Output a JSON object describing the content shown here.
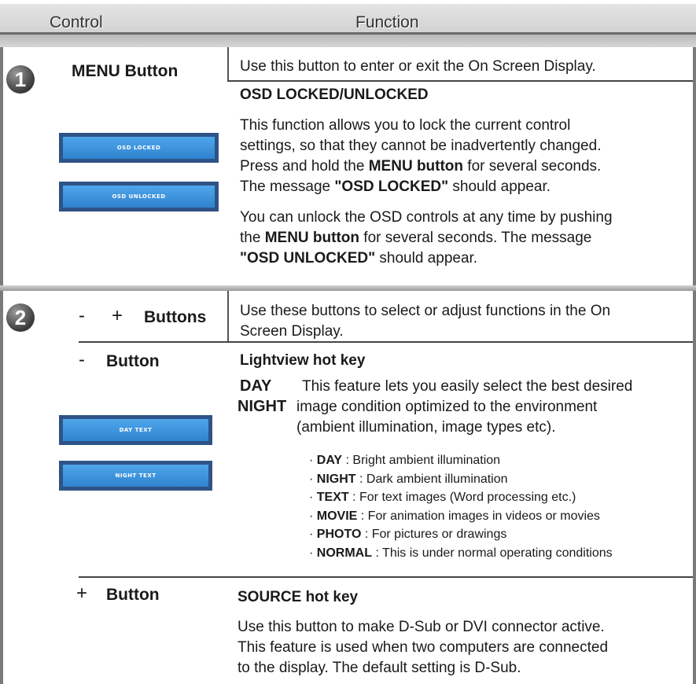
{
  "header": {
    "control": "Control",
    "function": "Function"
  },
  "row1": {
    "number": "1",
    "control_label": "MENU Button",
    "desc": "Use this button to enter or exit the On Screen Display.",
    "osd_title": "OSD LOCKED/UNLOCKED",
    "p1_a": "This function allows you to lock the current control",
    "p1_b": "settings, so that they cannot be inadvertently changed.",
    "p1_c1": "Press and hold the ",
    "p1_c2": "MENU button",
    "p1_c3": " for several seconds.",
    "p1_d1": "The message ",
    "p1_d2": "\"OSD LOCKED\"",
    "p1_d3": " should appear.",
    "p2_a": "You can unlock the OSD controls at any time by pushing",
    "p2_b1": "the ",
    "p2_b2": "MENU button",
    "p2_b3": " for several seconds. The message",
    "p2_c1": "\"OSD UNLOCKED\"",
    "p2_c2": " should appear.",
    "osd_locked": "OSD LOCKED",
    "osd_unlocked": "OSD UNLOCKED"
  },
  "row2": {
    "number": "2",
    "minus": "-",
    "plus": "+",
    "buttons_label": "Buttons",
    "desc_a": "Use these buttons to select or adjust functions in the On",
    "desc_b": "Screen Display.",
    "minus_button_label": "Button",
    "lightview_title": "Lightview hot key",
    "day": "DAY",
    "night": "NIGHT",
    "feat_a": "This feature lets you easily select the best desired",
    "feat_b": "image condition optimized to the environment",
    "feat_c": "(ambient illumination, image types etc).",
    "day_text": "DAY TEXT",
    "night_text": "NIGHT TEXT",
    "bullets": [
      {
        "key": "DAY",
        "text": " : Bright ambient illumination"
      },
      {
        "key": "NIGHT",
        "text": " : Dark ambient illumination"
      },
      {
        "key": "TEXT",
        "text": " : For text images (Word processing etc.)"
      },
      {
        "key": "MOVIE",
        "text": " : For animation images in videos or movies"
      },
      {
        "key": "PHOTO",
        "text": " : For pictures or drawings"
      },
      {
        "key": "NORMAL",
        "text": " : This is under normal operating conditions"
      }
    ],
    "plus_button_label": "Button",
    "source_title": "SOURCE hot key",
    "src_a": "Use this button to make D-Sub or DVI connector active.",
    "src_b": "This feature is used when two computers are connected",
    "src_c": "to the display. The default setting is D-Sub."
  }
}
